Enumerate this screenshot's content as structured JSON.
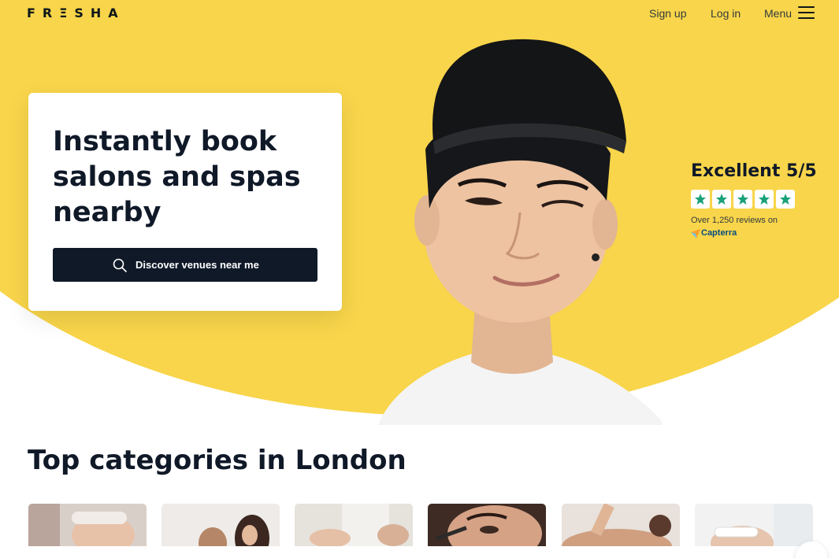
{
  "brand": {
    "logo_text": "FRΞSHA",
    "accent_color": "#f8d54a",
    "dark_color": "#101928"
  },
  "nav": {
    "signup_label": "Sign up",
    "login_label": "Log in",
    "menu_label": "Menu",
    "menu_icon": "hamburger-icon"
  },
  "hero": {
    "title": "Instantly book salons and spas nearby",
    "button_label": "Discover venues near me",
    "button_icon": "search-icon"
  },
  "rating": {
    "title": "Excellent 5/5",
    "stars": 5,
    "star_color": "#1aa17a",
    "reviews_text": "Over 1,250 reviews on",
    "provider": "Capterra"
  },
  "categories": {
    "title": "Top categories in London",
    "tiles": [
      "facial",
      "hair",
      "nails",
      "brows",
      "massage",
      "skincare"
    ]
  }
}
